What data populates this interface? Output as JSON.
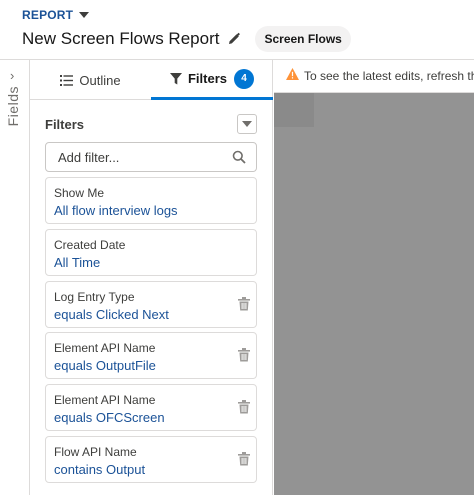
{
  "header": {
    "report_label": "REPORT",
    "title": "New Screen Flows Report",
    "type_badge": "Screen Flows"
  },
  "fields_rail": {
    "label": "Fields",
    "chevron": "›"
  },
  "tabs": {
    "outline_label": "Outline",
    "filters_label": "Filters",
    "filters_count": "4"
  },
  "filters": {
    "heading": "Filters",
    "search_placeholder": "Add filter...",
    "items": [
      {
        "label": "Show Me",
        "value": "All flow interview logs",
        "removable": false
      },
      {
        "label": "Created Date",
        "value": "All Time",
        "removable": false
      },
      {
        "label": "Log Entry Type",
        "value": "equals Clicked Next",
        "removable": true
      },
      {
        "label": "Element API Name",
        "value": "equals OutputFile",
        "removable": true
      },
      {
        "label": "Element API Name",
        "value": "equals OFCScreen",
        "removable": true
      },
      {
        "label": "Flow API Name",
        "value": "contains Output",
        "removable": true
      }
    ]
  },
  "preview": {
    "notice": "To see the latest edits, refresh the preview."
  },
  "colors": {
    "accent": "#0176d3",
    "link": "#1b5297",
    "warning": "#fe9339",
    "preview_gray": "#939393"
  }
}
